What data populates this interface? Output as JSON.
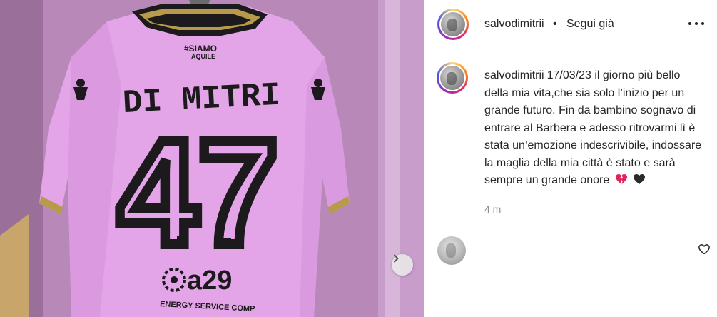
{
  "post": {
    "jersey": {
      "hashtag_line1": "#SIAMO",
      "hashtag_line2": "AQUILE",
      "name": "DI MITRI",
      "number": "47",
      "sponsor": "a29",
      "sponsor_tag": "ENERGY SERVICE COMP"
    },
    "next_icon": "chevron-right-icon"
  },
  "header": {
    "username": "salvodimitrii",
    "separator": "•",
    "follow_label": "Segui già",
    "more_icon": "more-horizontal-icon"
  },
  "caption": {
    "username": "salvodimitrii",
    "date": "17/03/23",
    "text": "il giorno più bello della mia vita,che sia solo l’inizio per un grande futuro. Fin da bambino sognavo di entrare al Barbera e adesso ritrovarmi lì è stata un’emozione indescrivibile, indossare la maglia della mia città è stato e sarà sempre un grande onore",
    "emojis": [
      "broken-heart-red",
      "black-heart"
    ],
    "time_ago": "4 m"
  },
  "comment": {
    "like_icon": "heart-outline-icon"
  },
  "colors": {
    "jersey_pink": "#e6a6ea",
    "jersey_dark": "#1c1a1c",
    "jersey_gold": "#b79a4a",
    "panel_text": "#262626",
    "muted_text": "#8e8e8e"
  }
}
